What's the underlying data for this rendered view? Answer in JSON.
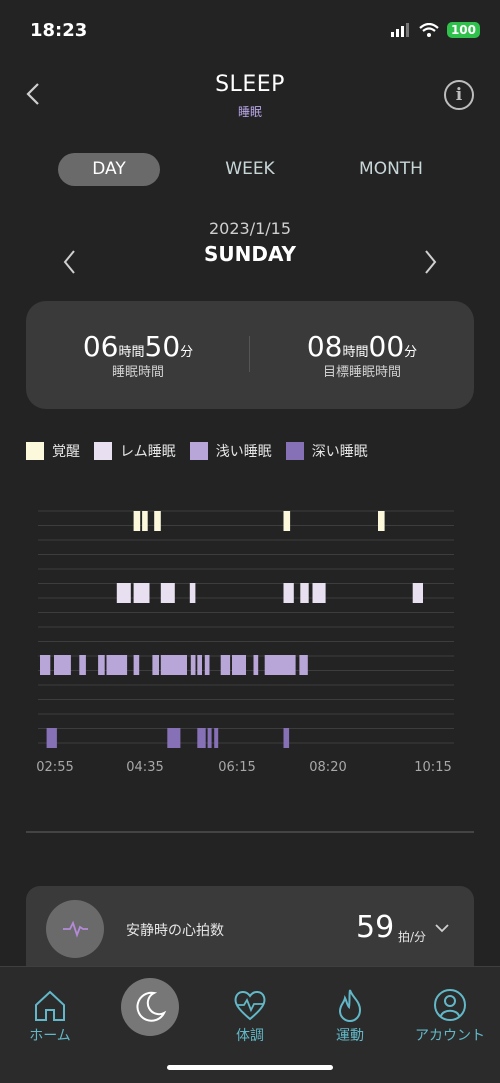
{
  "status_bar": {
    "time": "18:23",
    "battery": "100"
  },
  "header": {
    "title": "SLEEP",
    "subtitle": "睡眠"
  },
  "tabs": [
    {
      "label": "DAY",
      "active": true
    },
    {
      "label": "WEEK",
      "active": false
    },
    {
      "label": "MONTH",
      "active": false
    }
  ],
  "date": {
    "date": "2023/1/15",
    "weekday": "SUNDAY"
  },
  "summary": {
    "sleep": {
      "hours": "06",
      "hour_unit": "時間",
      "minutes": "50",
      "minute_unit": "分",
      "label": "睡眠時間"
    },
    "goal": {
      "hours": "08",
      "hour_unit": "時間",
      "minutes": "00",
      "minute_unit": "分",
      "label": "目標睡眠時間"
    }
  },
  "legend": [
    {
      "label": "覚醒",
      "color": "#fbf8dc"
    },
    {
      "label": "レム睡眠",
      "color": "#e8e0f0"
    },
    {
      "label": "浅い睡眠",
      "color": "#b8a6d8"
    },
    {
      "label": "深い睡眠",
      "color": "#8670b6"
    }
  ],
  "chart_data": {
    "type": "timeline",
    "x_range": [
      "02:55",
      "10:15"
    ],
    "tick_labels": [
      "02:55",
      "04:35",
      "06:15",
      "08:20",
      "10:15"
    ],
    "stages": [
      {
        "name": "覚醒",
        "segments": [
          [
            "04:35",
            "04:42"
          ],
          [
            "04:44",
            "04:50"
          ],
          [
            "04:57",
            "05:04"
          ],
          [
            "07:15",
            "07:22"
          ],
          [
            "08:56",
            "09:03"
          ]
        ]
      },
      {
        "name": "レム睡眠",
        "segments": [
          [
            "04:17",
            "04:32"
          ],
          [
            "04:35",
            "04:52"
          ],
          [
            "05:04",
            "05:19"
          ],
          [
            "05:35",
            "05:41"
          ],
          [
            "07:15",
            "07:26"
          ],
          [
            "07:33",
            "07:42"
          ],
          [
            "07:46",
            "08:00"
          ],
          [
            "09:33",
            "09:44"
          ]
        ]
      },
      {
        "name": "浅い睡眠",
        "segments": [
          [
            "02:55",
            "03:06"
          ],
          [
            "03:10",
            "03:28"
          ],
          [
            "03:37",
            "03:44"
          ],
          [
            "03:57",
            "04:04"
          ],
          [
            "04:06",
            "04:28"
          ],
          [
            "04:35",
            "04:41"
          ],
          [
            "04:55",
            "05:02"
          ],
          [
            "05:04",
            "05:32"
          ],
          [
            "05:36",
            "05:41"
          ],
          [
            "05:43",
            "05:48"
          ],
          [
            "05:51",
            "05:56"
          ],
          [
            "06:08",
            "06:18"
          ],
          [
            "06:20",
            "06:35"
          ],
          [
            "06:43",
            "06:48"
          ],
          [
            "06:55",
            "07:28"
          ],
          [
            "07:32",
            "07:41"
          ]
        ]
      },
      {
        "name": "深い睡眠",
        "segments": [
          [
            "03:02",
            "03:13"
          ],
          [
            "05:11",
            "05:25"
          ],
          [
            "05:43",
            "05:52"
          ],
          [
            "05:54",
            "05:58"
          ],
          [
            "06:01",
            "06:04"
          ],
          [
            "07:15",
            "07:21"
          ]
        ]
      }
    ]
  },
  "heart_rate": {
    "label": "安静時の心拍数",
    "value": "59",
    "unit": "拍/分"
  },
  "tabbar": [
    {
      "label": "ホーム"
    },
    {
      "label": ""
    },
    {
      "label": "体調"
    },
    {
      "label": "運動"
    },
    {
      "label": "アカウント"
    }
  ]
}
